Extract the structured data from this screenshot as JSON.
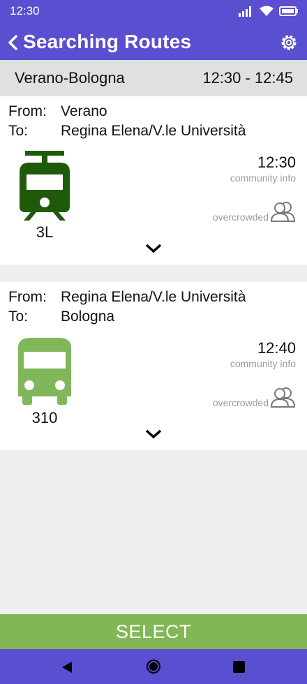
{
  "status": {
    "time": "12:30"
  },
  "header": {
    "title": "Searching Routes"
  },
  "route_bar": {
    "name": "Verano-Bologna",
    "time_range": "12:30 - 12:45"
  },
  "legs": [
    {
      "from_label": "From:",
      "from": "Verano",
      "to_label": "To:",
      "to": "Regina Elena/V.le Università",
      "vehicle": "tram-icon",
      "vehicle_color": "#1e5a0a",
      "line": "3L",
      "time": "12:30",
      "community_info": "community info",
      "crowd_status": "overcrowded"
    },
    {
      "from_label": "From:",
      "from": "Regina Elena/V.le Università",
      "to_label": "To:",
      "to": "Bologna",
      "vehicle": "bus-icon",
      "vehicle_color": "#7fb75a",
      "line": "310",
      "time": "12:40",
      "community_info": "community info",
      "crowd_status": "overcrowded"
    }
  ],
  "select_button": {
    "label": "SELECT"
  },
  "colors": {
    "primary": "#5a4fd0",
    "accent": "#82b755",
    "route_bar": "#dfe0e0"
  }
}
